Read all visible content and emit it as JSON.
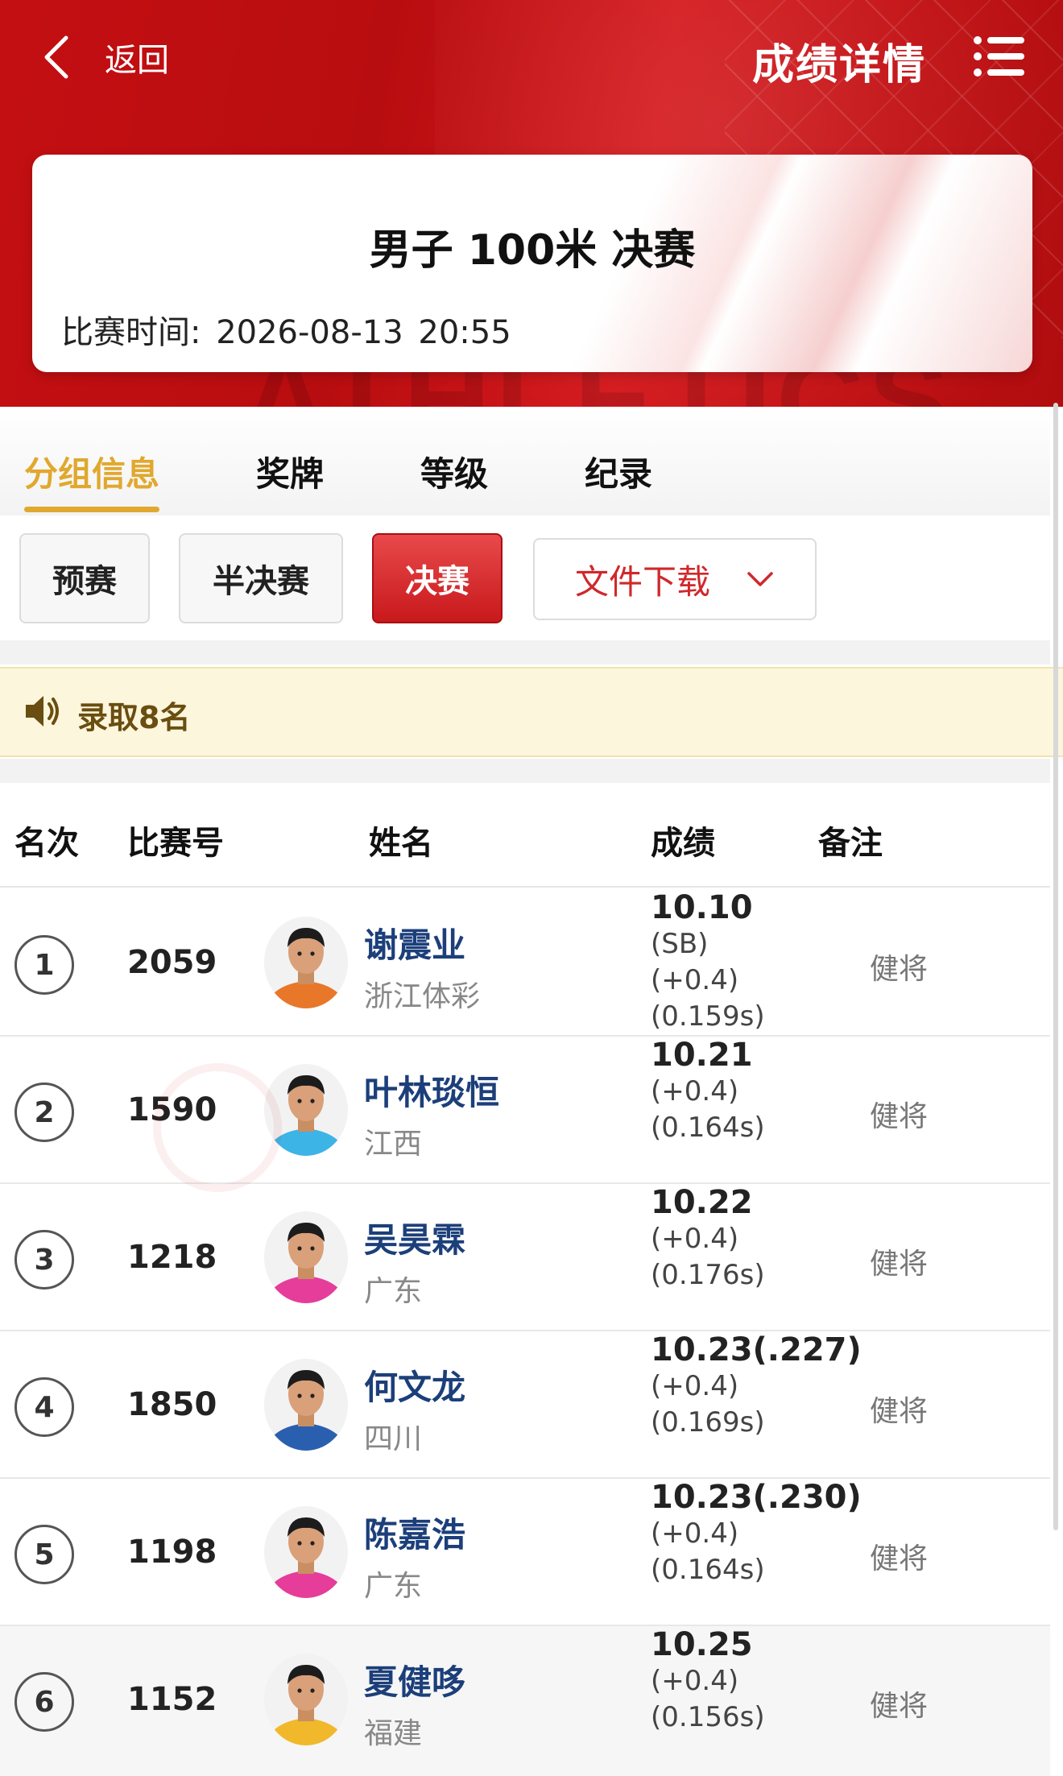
{
  "header": {
    "back_label": "返回",
    "title": "成绩详情",
    "watermark": "ATHLETICS"
  },
  "event": {
    "name": "男子 100米 决赛",
    "time_label": "比赛时间:",
    "date": "2026-08-13",
    "time": "20:55"
  },
  "tabs": [
    {
      "label": "分组信息",
      "active": true
    },
    {
      "label": "奖牌",
      "active": false
    },
    {
      "label": "等级",
      "active": false
    },
    {
      "label": "纪录",
      "active": false
    }
  ],
  "rounds": [
    {
      "label": "预赛",
      "active": false
    },
    {
      "label": "半决赛",
      "active": false
    },
    {
      "label": "决赛",
      "active": true
    }
  ],
  "download": {
    "label": "文件下载"
  },
  "notice": {
    "text": "录取8名"
  },
  "table": {
    "columns": [
      "名次",
      "比赛号",
      "姓名",
      "成绩",
      "备注"
    ],
    "rows": [
      {
        "rank": "1",
        "bib": "2059",
        "name": "谢震业",
        "team": "浙江体彩",
        "mark": "10.10",
        "details": [
          "(SB)",
          "(+0.4)",
          "(0.159s)"
        ],
        "remark": "健将"
      },
      {
        "rank": "2",
        "bib": "1590",
        "name": "叶林琰恒",
        "team": "江西",
        "mark": "10.21",
        "details": [
          "(+0.4)",
          "(0.164s)"
        ],
        "remark": "健将"
      },
      {
        "rank": "3",
        "bib": "1218",
        "name": "吴昊霖",
        "team": "广东",
        "mark": "10.22",
        "details": [
          "(+0.4)",
          "(0.176s)"
        ],
        "remark": "健将"
      },
      {
        "rank": "4",
        "bib": "1850",
        "name": "何文龙",
        "team": "四川",
        "mark": "10.23(.227)",
        "details": [
          "(+0.4)",
          "(0.169s)"
        ],
        "remark": "健将"
      },
      {
        "rank": "5",
        "bib": "1198",
        "name": "陈嘉浩",
        "team": "广东",
        "mark": "10.23(.230)",
        "details": [
          "(+0.4)",
          "(0.164s)"
        ],
        "remark": "健将"
      },
      {
        "rank": "6",
        "bib": "1152",
        "name": "夏健哆",
        "team": "福建",
        "mark": "10.25",
        "details": [
          "(+0.4)",
          "(0.156s)"
        ],
        "remark": "健将"
      }
    ]
  },
  "colors": {
    "brand_red": "#c40f12",
    "active_tab": "#e0a82e",
    "name_blue": "#1c3f7a"
  },
  "jersey_colors": [
    "#e8772a",
    "#3cb4e6",
    "#e63c9a",
    "#2a5fb0",
    "#e63c9a",
    "#f0b82a"
  ]
}
